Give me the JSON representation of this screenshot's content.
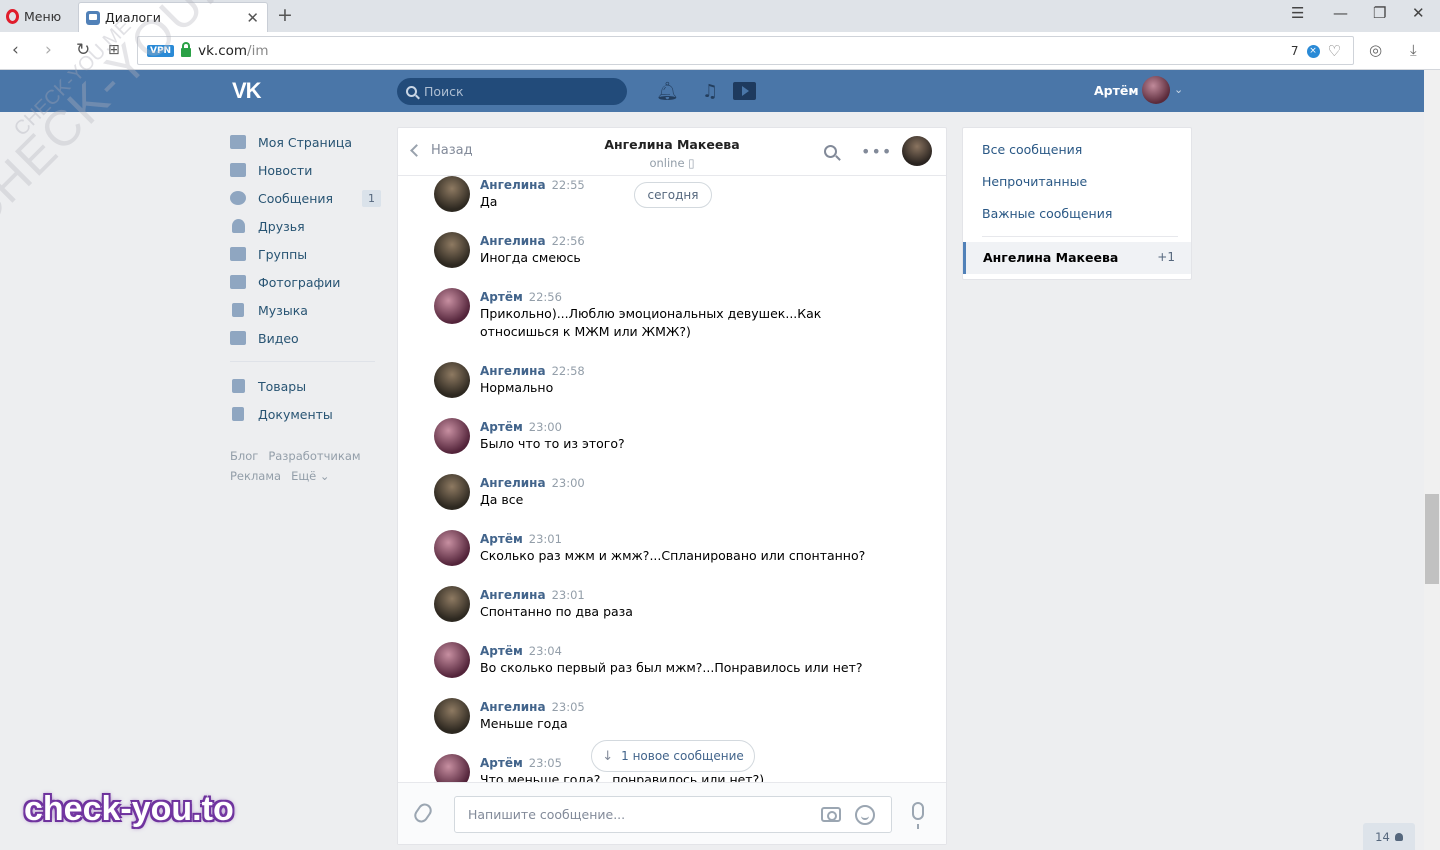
{
  "browser": {
    "menu_label": "Меню",
    "tab_title": "Диалоги",
    "url_host": "vk.com",
    "url_path": "/im",
    "vpn_label": "VPN",
    "blocked_count": "7",
    "icons": [
      "back-icon",
      "forward-icon",
      "reload-icon",
      "speed-dial-icon",
      "heart-icon",
      "snapshot-icon",
      "download-icon"
    ]
  },
  "header": {
    "logo": "VK",
    "search_placeholder": "Поиск",
    "user_name": "Артём",
    "brand_color": "#4a76a8"
  },
  "leftnav": {
    "items": [
      {
        "label": "Моя Страница",
        "icon": "home-icon"
      },
      {
        "label": "Новости",
        "icon": "news-icon"
      },
      {
        "label": "Сообщения",
        "icon": "messages-icon",
        "badge": "1"
      },
      {
        "label": "Друзья",
        "icon": "friends-icon"
      },
      {
        "label": "Группы",
        "icon": "groups-icon"
      },
      {
        "label": "Фотографии",
        "icon": "photos-icon"
      },
      {
        "label": "Музыка",
        "icon": "music-icon"
      },
      {
        "label": "Видео",
        "icon": "video-icon"
      }
    ],
    "items2": [
      {
        "label": "Товары",
        "icon": "market-icon"
      },
      {
        "label": "Документы",
        "icon": "documents-icon"
      }
    ],
    "footer": [
      "Блог",
      "Разработчикам",
      "Реклама",
      "Ещё ⌄"
    ]
  },
  "chat": {
    "back_label": "Назад",
    "peer_name": "Ангелина Макеева",
    "peer_status": "online",
    "today_label": "сегодня",
    "new_message_label": "1 новое сообщение",
    "input_placeholder": "Напишите сообщение...",
    "messages": [
      {
        "author": "Ангелина",
        "time": "22:55",
        "text": "Да",
        "who": "ang"
      },
      {
        "author": "Ангелина",
        "time": "22:56",
        "text": "Иногда смеюсь",
        "who": "ang"
      },
      {
        "author": "Артём",
        "time": "22:56",
        "text": "Прикольно)...Люблю эмоциональных девушек...Как относишься к МЖМ или ЖМЖ?)",
        "who": "art"
      },
      {
        "author": "Ангелина",
        "time": "22:58",
        "text": "Нормально",
        "who": "ang"
      },
      {
        "author": "Артём",
        "time": "23:00",
        "text": "Было что то из этого?",
        "who": "art"
      },
      {
        "author": "Ангелина",
        "time": "23:00",
        "text": "Да все",
        "who": "ang"
      },
      {
        "author": "Артём",
        "time": "23:01",
        "text": "Сколько раз мжм и жмж?...Спланировано или спонтанно?",
        "who": "art"
      },
      {
        "author": "Ангелина",
        "time": "23:01",
        "text": "Спонтанно по два раза",
        "who": "ang"
      },
      {
        "author": "Артём",
        "time": "23:04",
        "text": "Во сколько первый раз был мжм?...Понравилось или нет?",
        "who": "art"
      },
      {
        "author": "Ангелина",
        "time": "23:05",
        "text": "Меньше года",
        "who": "ang"
      },
      {
        "author": "Артём",
        "time": "23:05",
        "text": "Что меньше года?...понравилось или нет?)",
        "who": "art"
      }
    ]
  },
  "rightpanel": {
    "all": "Все сообщения",
    "unread": "Непрочитанные",
    "important": "Важные сообщения",
    "active_name": "Ангелина Макеева",
    "active_count": "+1"
  },
  "online_count": "14",
  "watermarks": {
    "diag": "CHECK-YOU.ME",
    "diag_small": "CHECK-YOU.ME",
    "bottom": "check-you.to"
  }
}
